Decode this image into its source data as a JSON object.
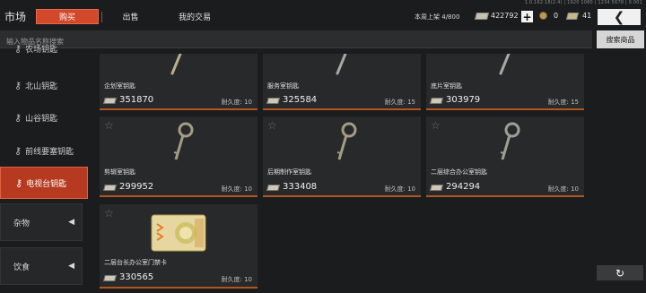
{
  "version_text": "1.0.162.18(2.4) | 1920 1080 | 1234 5678 | 0.001",
  "header": {
    "title": "市场",
    "tabs": [
      {
        "label": "购买"
      },
      {
        "label": "出售"
      },
      {
        "label": "我的交易"
      }
    ],
    "weekly_label": "本周上架",
    "weekly_count": "4/800",
    "money": "422792",
    "coins": "0",
    "tokens": "41",
    "plus_symbol": "+",
    "back_symbol": "❮"
  },
  "search": {
    "placeholder": "输入物品名称搜索",
    "button_label": "搜索商品"
  },
  "sidebar": {
    "items": [
      {
        "label": "农场钥匙"
      },
      {
        "label": "北山钥匙"
      },
      {
        "label": "山谷钥匙"
      },
      {
        "label": "前线要塞钥匙"
      },
      {
        "label": "电视台钥匙",
        "active": true
      }
    ],
    "categories": [
      {
        "label": "杂物"
      },
      {
        "label": "饮食"
      }
    ]
  },
  "items": [
    {
      "name": "企划室钥匙",
      "price": "351870",
      "durability": "耐久度: 10",
      "icon": "key-icon"
    },
    {
      "name": "服务室钥匙",
      "price": "325584",
      "durability": "耐久度: 15",
      "icon": "key-icon"
    },
    {
      "name": "底片室钥匙",
      "price": "303979",
      "durability": "耐久度: 15",
      "icon": "key-icon"
    },
    {
      "name": "剪辑室钥匙",
      "price": "299952",
      "durability": "耐久度: 10",
      "icon": "key-icon"
    },
    {
      "name": "后期制作室钥匙",
      "price": "333408",
      "durability": "耐久度: 10",
      "icon": "key-icon"
    },
    {
      "name": "二层综合办公室钥匙",
      "price": "294294",
      "durability": "耐久度: 10",
      "icon": "key-icon"
    },
    {
      "name": "二层台长办公室门禁卡",
      "price": "330565",
      "durability": "耐久度: 10",
      "icon": "keycard-icon"
    }
  ],
  "refresh_symbol": "↻",
  "colors": {
    "accent": "#d2482a",
    "card_border": "#b2561f"
  }
}
